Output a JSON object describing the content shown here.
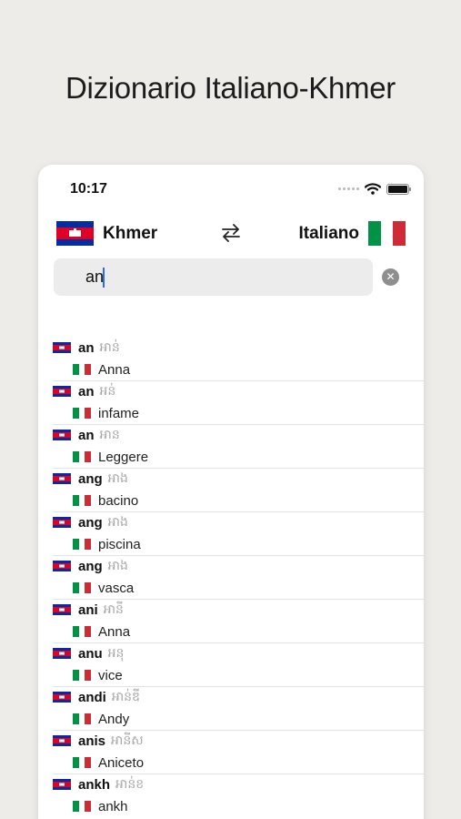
{
  "headline": "Dizionario Italiano-Khmer",
  "status_bar": {
    "time": "10:17"
  },
  "languages": {
    "source": "Khmer",
    "target": "Italiano"
  },
  "search": {
    "value": "an",
    "placeholder": ""
  },
  "colors": {
    "kh_blue": "#032ea1",
    "kh_red": "#e00025",
    "it_green": "#009246",
    "it_white": "#ffffff",
    "it_red": "#ce2b37",
    "cursor": "#2a6fdb"
  },
  "icons": {
    "swap": "swap-arrows-icon",
    "clear": "clear-search-icon",
    "wifi": "wifi-icon",
    "battery": "battery-icon",
    "signal": "signal-icon"
  },
  "results": [
    {
      "word": "an",
      "script": "អាន់",
      "translation": "Anna"
    },
    {
      "word": "an",
      "script": "អន់",
      "translation": "infame"
    },
    {
      "word": "an",
      "script": "អាន",
      "translation": "Leggere"
    },
    {
      "word": "ang",
      "script": "អាង",
      "translation": "bacino"
    },
    {
      "word": "ang",
      "script": "អាង",
      "translation": "piscina"
    },
    {
      "word": "ang",
      "script": "អាង",
      "translation": "vasca"
    },
    {
      "word": "ani",
      "script": "អានី",
      "translation": "Anna"
    },
    {
      "word": "anu",
      "script": "អនុ",
      "translation": "vice"
    },
    {
      "word": "andi",
      "script": "អាន់ឌី",
      "translation": "Andy"
    },
    {
      "word": "anis",
      "script": "អានីស",
      "translation": "Aniceto"
    },
    {
      "word": "ankh",
      "script": "អាន់ខ",
      "translation": "ankh"
    }
  ]
}
